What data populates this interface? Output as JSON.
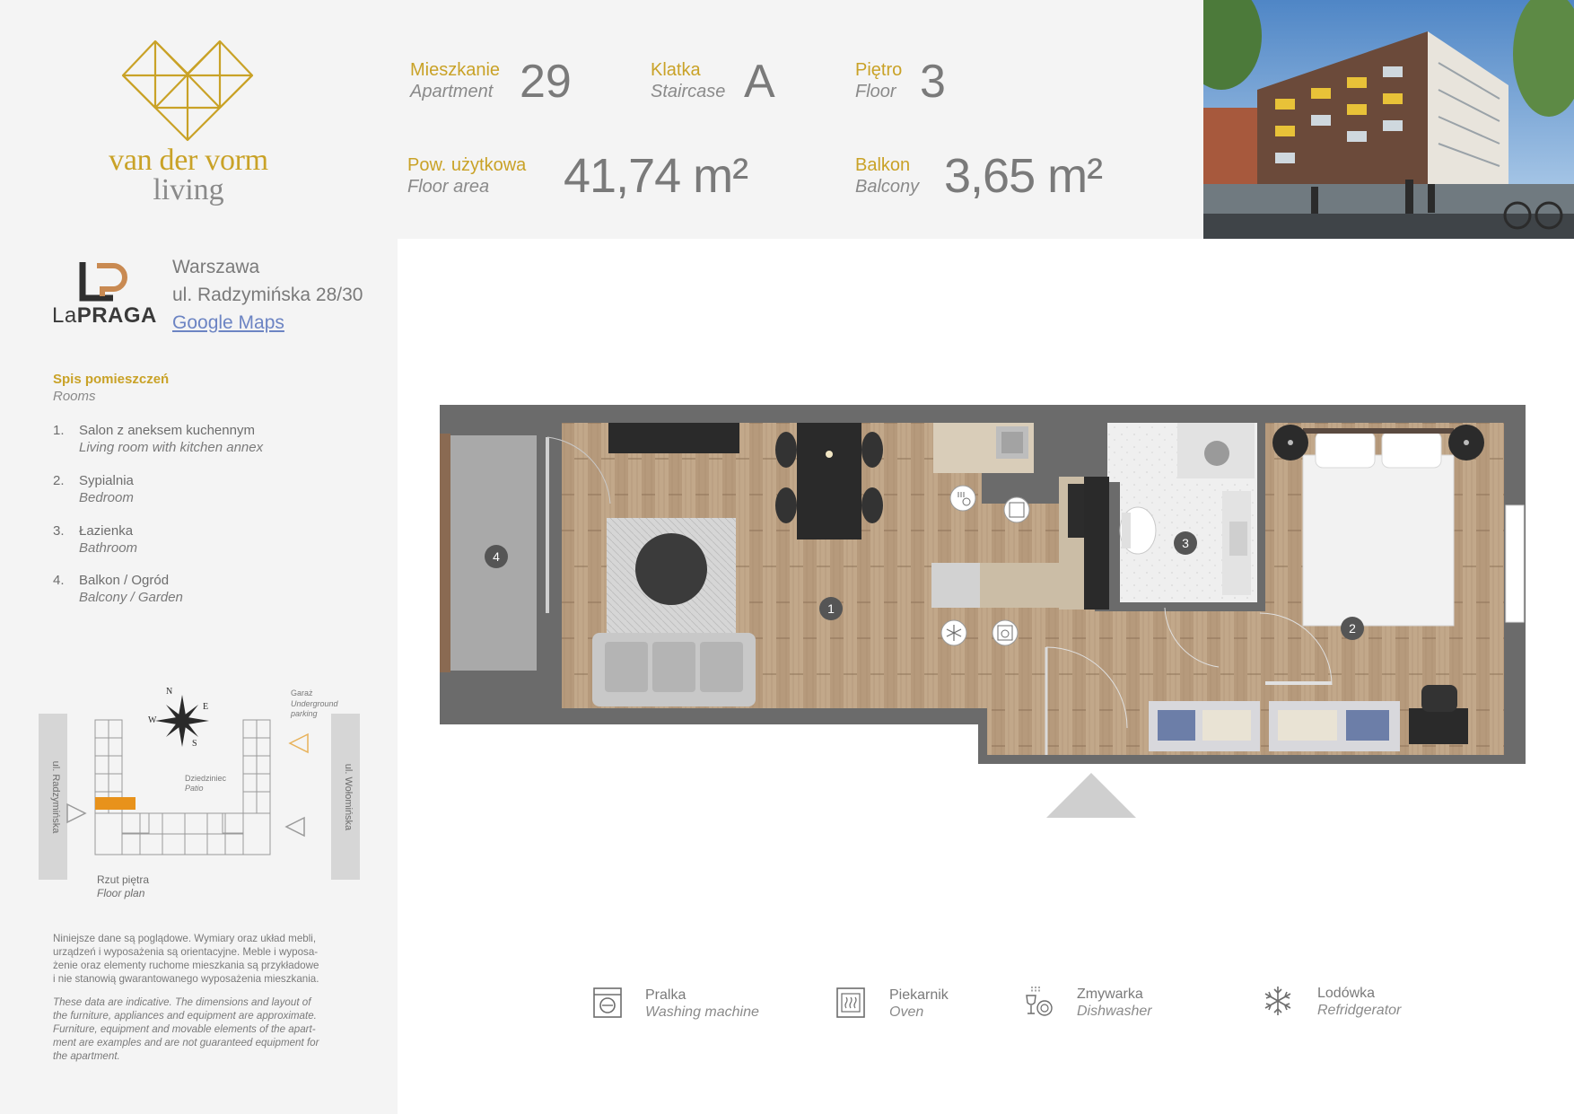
{
  "brand": {
    "line1": "van der vorm",
    "line2": "living",
    "colors": {
      "gold": "#c9a227",
      "grey": "#8a8a8a"
    }
  },
  "investment": {
    "logo_light": "La",
    "logo_bold": "PRAGA",
    "city": "Warszawa",
    "street": "ul. Radzymińska 28/30",
    "map_link": "Google Maps"
  },
  "apartment": {
    "number_pl": "Mieszkanie",
    "number_en": "Apartment",
    "number_value": "29",
    "staircase_pl": "Klatka",
    "staircase_en": "Staircase",
    "staircase_value": "A",
    "floor_pl": "Piętro",
    "floor_en": "Floor",
    "floor_value": "3",
    "area_pl": "Pow. użytkowa",
    "area_en": "Floor area",
    "area_value": "41,74 m²",
    "balcony_pl": "Balkon",
    "balcony_en": "Balcony",
    "balcony_value": "3,65 m²"
  },
  "rooms": {
    "title_pl": "Spis pomieszczeń",
    "title_en": "Rooms",
    "items": [
      {
        "num": "1.",
        "pl": "Salon z aneksem kuchennym",
        "en": "Living room with kitchen annex"
      },
      {
        "num": "2.",
        "pl": "Sypialnia",
        "en": "Bedroom"
      },
      {
        "num": "3.",
        "pl": "Łazienka",
        "en": "Bathroom"
      },
      {
        "num": "4.",
        "pl": "Balkon / Ogród",
        "en": "Balcony / Garden"
      }
    ]
  },
  "siteplan": {
    "north": "N",
    "east": "E",
    "south": "S",
    "west": "W",
    "garage_pl": "Garaż",
    "garage_en1": "Underground",
    "garage_en2": "parking",
    "patio_pl": "Dziedziniec",
    "patio_en": "Patio",
    "street_left": "ul. Radzymińska",
    "street_right": "ul. Wołomińska",
    "caption_pl": "Rzut piętra",
    "caption_en": "Floor plan"
  },
  "plan_markers": [
    "1",
    "2",
    "3",
    "4"
  ],
  "disclaimer": {
    "pl_lines": [
      "Niniejsze dane są poglądowe. Wymiary oraz układ mebli,",
      "urządzeń i wyposażenia są orientacyjne. Meble i wyposa-",
      "żenie oraz elementy ruchome mieszkania są przykładowe",
      "i nie stanowią gwarantowanego wyposażenia mieszkania."
    ],
    "en_lines": [
      "These data are indicative. The dimensions and layout of",
      "the furniture, appliances and equipment are approximate.",
      "Furniture, equipment and movable elements of the apart-",
      "ment are examples and are not guaranteed equipment for",
      "the apartment."
    ]
  },
  "legend": [
    {
      "icon": "washing-machine-icon",
      "pl": "Pralka",
      "en": "Washing machine"
    },
    {
      "icon": "oven-icon",
      "pl": "Piekarnik",
      "en": "Oven"
    },
    {
      "icon": "dishwasher-icon",
      "pl": "Zmywarka",
      "en": "Dishwasher"
    },
    {
      "icon": "refrigerator-icon",
      "pl": "Lodówka",
      "en": "Refridgerator"
    }
  ],
  "colors": {
    "wall": "#6b6b6b",
    "wood": "#b89d7f",
    "tile": "#e9e9e9",
    "highlight": "#e8921b",
    "link": "#6c84c3"
  }
}
